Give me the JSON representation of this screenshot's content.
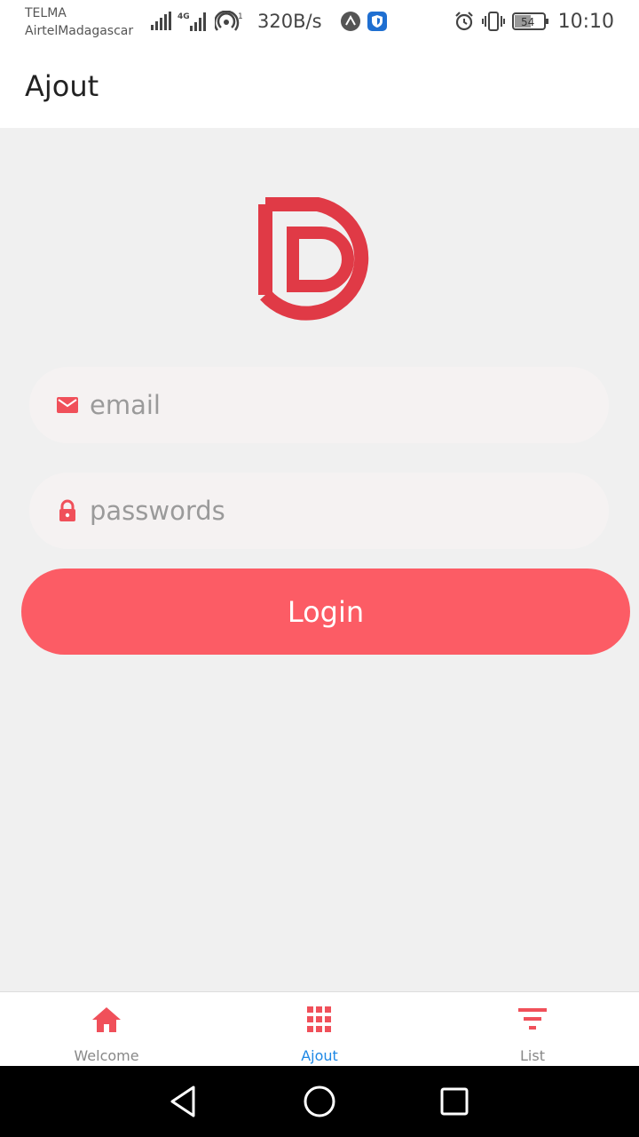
{
  "status_bar": {
    "carrier_1": "TELMA",
    "carrier_2": "AirtelMadagascar",
    "net_speed": "320B/s",
    "battery": "54",
    "time": "10:10"
  },
  "app_bar": {
    "title": "Ajout"
  },
  "login": {
    "email_placeholder": "email",
    "password_placeholder": "passwords",
    "button_label": "Login"
  },
  "bottom_nav": {
    "tabs": [
      {
        "label": "Welcome",
        "icon": "home-icon"
      },
      {
        "label": "Ajout",
        "icon": "grid-icon"
      },
      {
        "label": "List",
        "icon": "filter-icon"
      }
    ],
    "active_index": 1
  },
  "colors": {
    "accent": "#fc5c65",
    "logo": "#e03a46",
    "active_tab": "#1e88e5"
  }
}
